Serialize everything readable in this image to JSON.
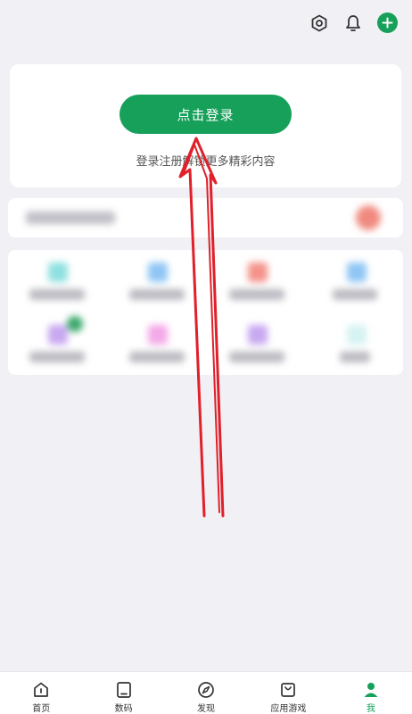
{
  "topbar": {
    "settings_icon": "settings-hex-icon",
    "bell_icon": "bell-icon",
    "add_icon": "plus-icon"
  },
  "login": {
    "button_label": "点击登录",
    "hint": "登录注册解锁更多精彩内容"
  },
  "bottom_nav": {
    "items": [
      {
        "label": "首页",
        "icon": "home-icon"
      },
      {
        "label": "数码",
        "icon": "tablet-icon"
      },
      {
        "label": "发现",
        "icon": "compass-icon"
      },
      {
        "label": "应用游戏",
        "icon": "shopping-bag-icon"
      },
      {
        "label": "我",
        "icon": "person-icon"
      }
    ]
  },
  "colors": {
    "accent": "#16a05a",
    "background": "#f1f1f5",
    "annotation_arrow": "#e0202a"
  }
}
